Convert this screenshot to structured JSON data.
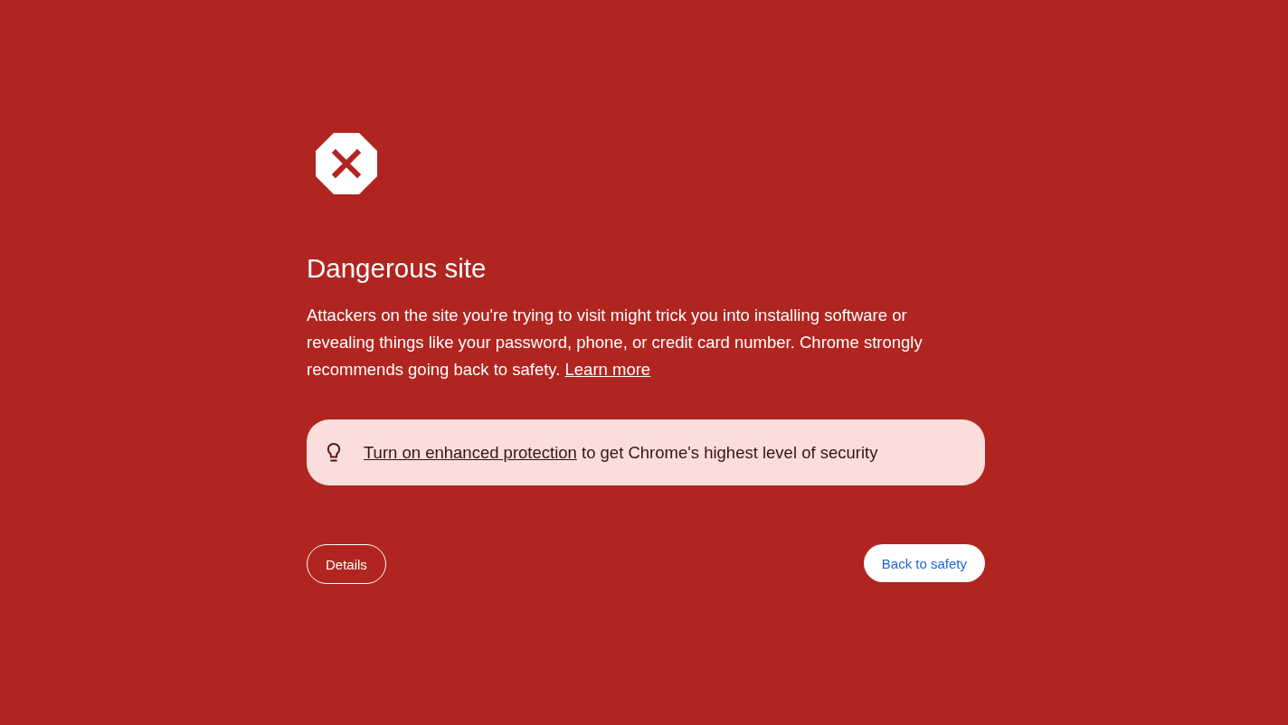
{
  "heading": "Dangerous site",
  "message": {
    "text": "Attackers on the site you're trying to visit might trick you into installing software or revealing things like your password, phone, or credit card number. Chrome strongly recommends going back to safety.",
    "link": "Learn more"
  },
  "promo": {
    "link": "Turn on enhanced protection",
    "text": "to get Chrome's highest level of security"
  },
  "buttons": [
    {
      "label": "Details",
      "kind": "outline"
    },
    {
      "label": "Back to safety",
      "kind": "primary"
    }
  ]
}
